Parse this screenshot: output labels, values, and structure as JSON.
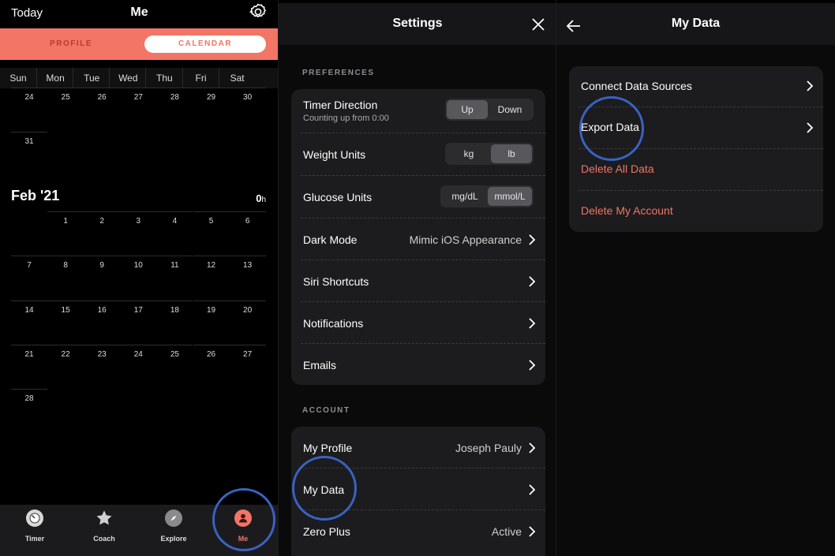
{
  "me_screen": {
    "today_label": "Today",
    "title": "Me",
    "tabs": {
      "profile": "PROFILE",
      "calendar": "CALENDAR",
      "active": "calendar"
    },
    "weekdays": [
      "Sun",
      "Mon",
      "Tue",
      "Wed",
      "Thu",
      "Fri",
      "Sat"
    ],
    "prev_month_rows": [
      [
        "24",
        "25",
        "26",
        "27",
        "28",
        "29",
        "30"
      ],
      [
        "31",
        "",
        "",
        "",
        "",
        "",
        ""
      ]
    ],
    "month": {
      "title": "Feb '21",
      "hours_value": "0",
      "hours_unit": "h"
    },
    "month_rows": [
      [
        "",
        "1",
        "2",
        "3",
        "4",
        "5",
        "6"
      ],
      [
        "7",
        "8",
        "9",
        "10",
        "11",
        "12",
        "13"
      ],
      [
        "14",
        "15",
        "16",
        "17",
        "18",
        "19",
        "20"
      ],
      [
        "21",
        "22",
        "23",
        "24",
        "25",
        "26",
        "27"
      ],
      [
        "28",
        "",
        "",
        "",
        "",
        "",
        ""
      ]
    ],
    "tabbar": [
      {
        "label": "Timer",
        "icon": "timer-icon"
      },
      {
        "label": "Coach",
        "icon": "star-icon"
      },
      {
        "label": "Explore",
        "icon": "compass-icon"
      },
      {
        "label": "Me",
        "icon": "person-icon",
        "active": true
      }
    ]
  },
  "settings": {
    "title": "Settings",
    "preferences_header": "PREFERENCES",
    "timer_direction": {
      "label": "Timer Direction",
      "sublabel": "Counting up from 0:00",
      "options": [
        "Up",
        "Down"
      ],
      "selected": "Up"
    },
    "weight_units": {
      "label": "Weight Units",
      "options": [
        "kg",
        "lb"
      ],
      "selected": "lb"
    },
    "glucose_units": {
      "label": "Glucose Units",
      "options": [
        "mg/dL",
        "mmol/L"
      ],
      "selected": "mmol/L"
    },
    "dark_mode": {
      "label": "Dark Mode",
      "value": "Mimic iOS Appearance"
    },
    "siri_shortcuts": {
      "label": "Siri Shortcuts"
    },
    "notifications": {
      "label": "Notifications"
    },
    "emails": {
      "label": "Emails"
    },
    "account_header": "ACCOUNT",
    "my_profile": {
      "label": "My Profile",
      "value": "Joseph Pauly"
    },
    "my_data": {
      "label": "My Data"
    },
    "zero_plus": {
      "label": "Zero Plus",
      "value": "Active"
    }
  },
  "my_data": {
    "title": "My Data",
    "items": [
      {
        "label": "Connect Data Sources",
        "chevron": true,
        "destructive": false
      },
      {
        "label": "Export Data",
        "chevron": true,
        "destructive": false
      },
      {
        "label": "Delete All Data",
        "chevron": false,
        "destructive": true
      },
      {
        "label": "Delete My Account",
        "chevron": false,
        "destructive": true
      }
    ]
  },
  "colors": {
    "accent": "#f27565",
    "highlight_circle": "#3a62c2",
    "card": "#1c1c1e"
  }
}
